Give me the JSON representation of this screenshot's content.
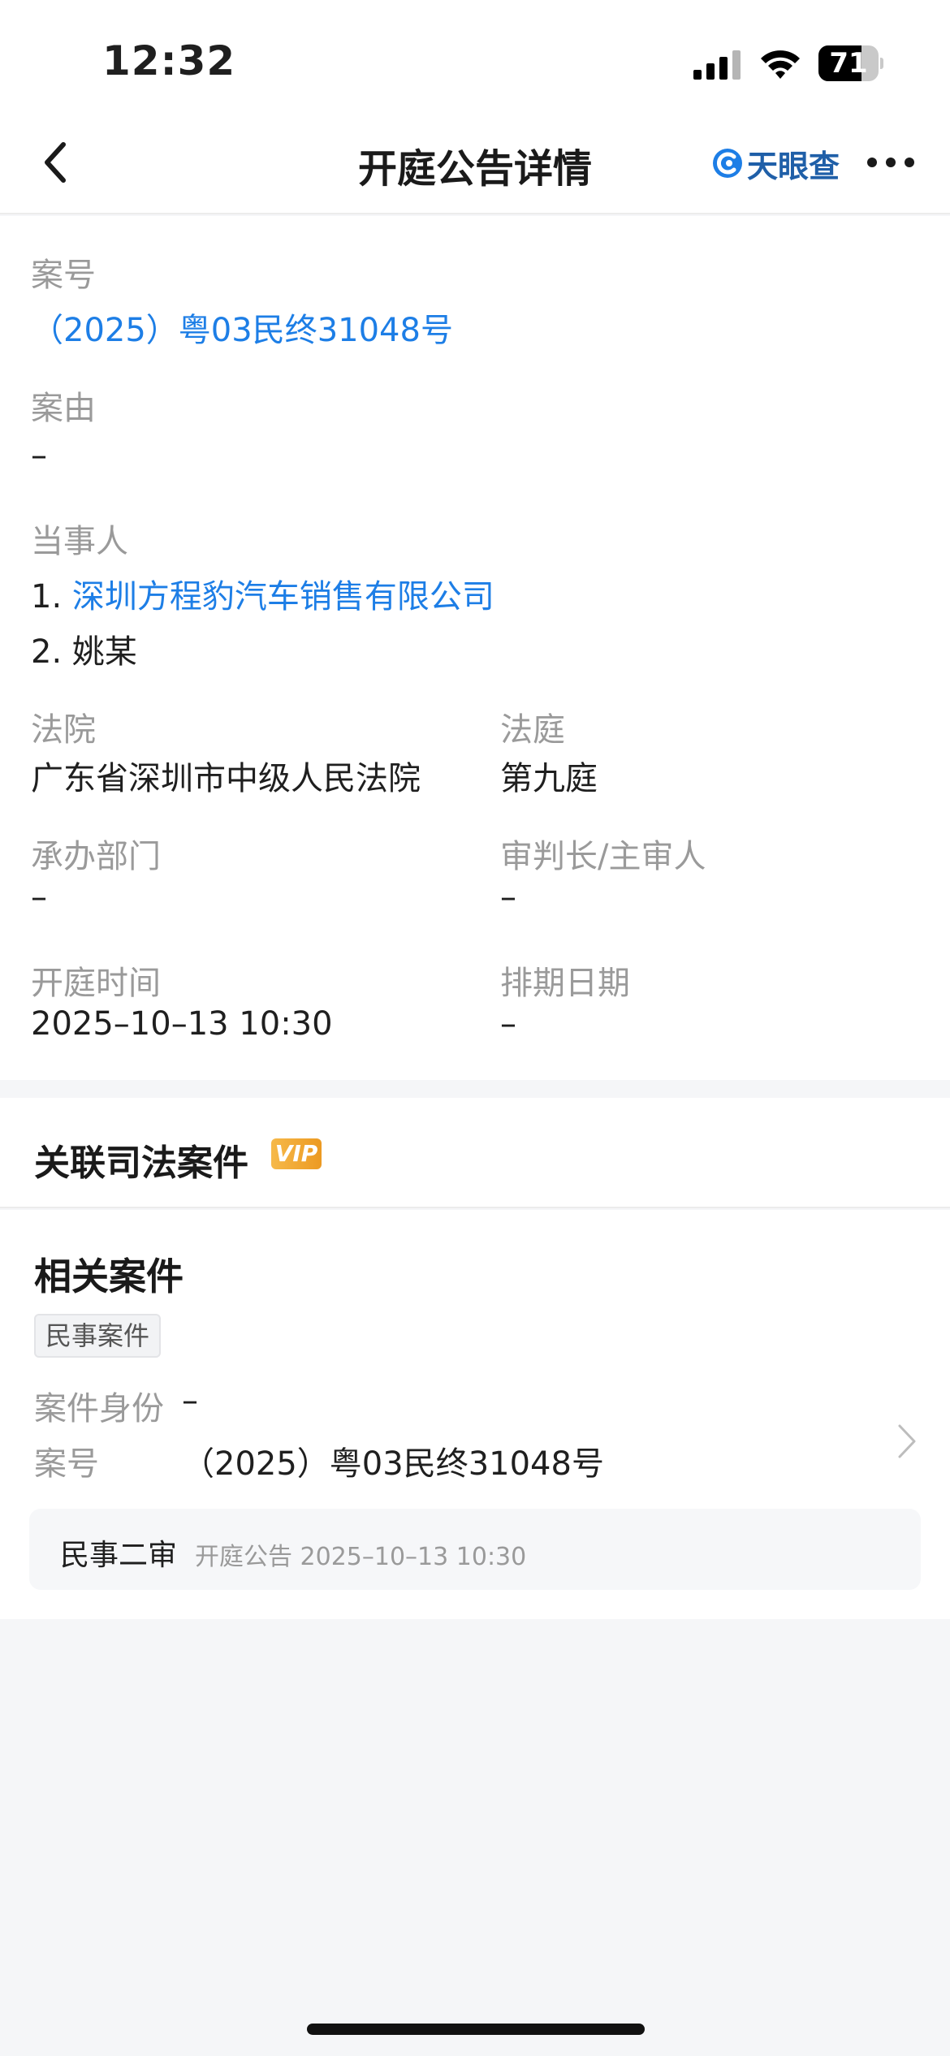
{
  "status_bar": {
    "time": "12:32",
    "battery_level": "71",
    "battery_fraction": 0.71
  },
  "navbar": {
    "title": "开庭公告详情",
    "brand": "天眼查"
  },
  "details": {
    "case_no_label": "案号",
    "case_no": "（2025）粤03民终31048号",
    "cause_label": "案由",
    "cause": "–",
    "parties_label": "当事人",
    "parties": [
      {
        "index": "1.",
        "name": "深圳方程豹汽车销售有限公司"
      },
      {
        "index": "2.",
        "name": "姚某"
      }
    ],
    "court_label": "法院",
    "court": "广东省深圳市中级人民法院",
    "courtroom_label": "法庭",
    "courtroom": "第九庭",
    "department_label": "承办部门",
    "department": "–",
    "judge_label": "审判长/主审人",
    "judge": "–",
    "hearing_time_label": "开庭时间",
    "hearing_time": "2025–10–13 10:30",
    "schedule_date_label": "排期日期",
    "schedule_date": "–"
  },
  "associated": {
    "title": "关联司法案件",
    "vip_badge": "VIP"
  },
  "related_case": {
    "title": "相关案件",
    "tag": "民事案件",
    "identity_label": "案件身份",
    "identity": "–",
    "case_no_label": "案号",
    "case_no": "（2025）粤03民终31048号",
    "record": {
      "type": "民事二审",
      "meta": "开庭公告 2025–10–13 10:30"
    }
  },
  "colors": {
    "link": "#1d7ee6",
    "label": "#9a9a9a",
    "brand": "#1f5fa8",
    "vip": "#ec9a22"
  }
}
